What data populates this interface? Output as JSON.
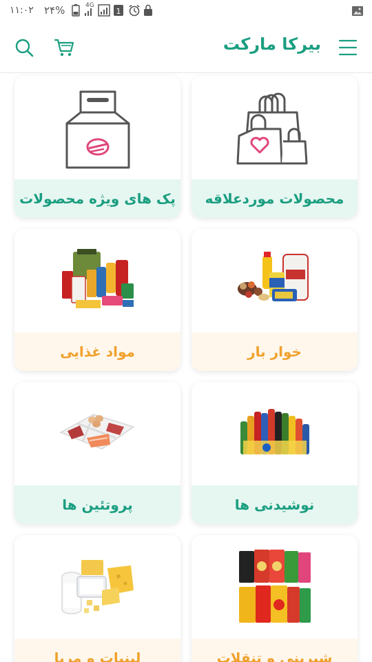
{
  "status_bar": {
    "time": "۱۱:۰۲",
    "battery_percent": "۲۴%",
    "network": "4G"
  },
  "app_bar": {
    "title": "بیرکا مارکت",
    "icons": [
      "menu-icon",
      "search-icon",
      "cart-icon"
    ]
  },
  "categories": [
    {
      "label": "محصولات موردعلاقه",
      "image": "shopping-bags-heart-icon",
      "style": "mint"
    },
    {
      "label": "پک های ویژه محصولات",
      "image": "gift-box-icon",
      "style": "mint"
    },
    {
      "label": "خوار بار",
      "image": "groceries-photo",
      "style": "cream"
    },
    {
      "label": "مواد غذایی",
      "image": "food-products-photo",
      "style": "cream"
    },
    {
      "label": "نوشیدنی ها",
      "image": "drinks-photo",
      "style": "mint"
    },
    {
      "label": "پروتئین ها",
      "image": "protein-tray-photo",
      "style": "mint"
    },
    {
      "label": "شیرینی و تنقلات",
      "image": "snacks-photo",
      "style": "cream"
    },
    {
      "label": "لبنیات و مربا",
      "image": "dairy-photo",
      "style": "cream"
    }
  ],
  "colors": {
    "brand": "#1a9e80",
    "mint_bar": "#e6f6f1",
    "cream_bar": "#fff7ec",
    "orange_text": "#f0a12c"
  }
}
